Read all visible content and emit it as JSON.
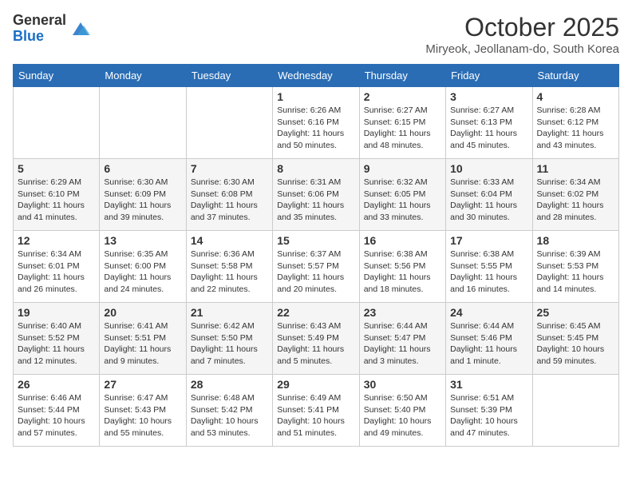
{
  "header": {
    "logo_general": "General",
    "logo_blue": "Blue",
    "month_title": "October 2025",
    "subtitle": "Miryeok, Jeollanam-do, South Korea"
  },
  "days_of_week": [
    "Sunday",
    "Monday",
    "Tuesday",
    "Wednesday",
    "Thursday",
    "Friday",
    "Saturday"
  ],
  "weeks": [
    [
      {
        "day": "",
        "info": ""
      },
      {
        "day": "",
        "info": ""
      },
      {
        "day": "",
        "info": ""
      },
      {
        "day": "1",
        "info": "Sunrise: 6:26 AM\nSunset: 6:16 PM\nDaylight: 11 hours\nand 50 minutes."
      },
      {
        "day": "2",
        "info": "Sunrise: 6:27 AM\nSunset: 6:15 PM\nDaylight: 11 hours\nand 48 minutes."
      },
      {
        "day": "3",
        "info": "Sunrise: 6:27 AM\nSunset: 6:13 PM\nDaylight: 11 hours\nand 45 minutes."
      },
      {
        "day": "4",
        "info": "Sunrise: 6:28 AM\nSunset: 6:12 PM\nDaylight: 11 hours\nand 43 minutes."
      }
    ],
    [
      {
        "day": "5",
        "info": "Sunrise: 6:29 AM\nSunset: 6:10 PM\nDaylight: 11 hours\nand 41 minutes."
      },
      {
        "day": "6",
        "info": "Sunrise: 6:30 AM\nSunset: 6:09 PM\nDaylight: 11 hours\nand 39 minutes."
      },
      {
        "day": "7",
        "info": "Sunrise: 6:30 AM\nSunset: 6:08 PM\nDaylight: 11 hours\nand 37 minutes."
      },
      {
        "day": "8",
        "info": "Sunrise: 6:31 AM\nSunset: 6:06 PM\nDaylight: 11 hours\nand 35 minutes."
      },
      {
        "day": "9",
        "info": "Sunrise: 6:32 AM\nSunset: 6:05 PM\nDaylight: 11 hours\nand 33 minutes."
      },
      {
        "day": "10",
        "info": "Sunrise: 6:33 AM\nSunset: 6:04 PM\nDaylight: 11 hours\nand 30 minutes."
      },
      {
        "day": "11",
        "info": "Sunrise: 6:34 AM\nSunset: 6:02 PM\nDaylight: 11 hours\nand 28 minutes."
      }
    ],
    [
      {
        "day": "12",
        "info": "Sunrise: 6:34 AM\nSunset: 6:01 PM\nDaylight: 11 hours\nand 26 minutes."
      },
      {
        "day": "13",
        "info": "Sunrise: 6:35 AM\nSunset: 6:00 PM\nDaylight: 11 hours\nand 24 minutes."
      },
      {
        "day": "14",
        "info": "Sunrise: 6:36 AM\nSunset: 5:58 PM\nDaylight: 11 hours\nand 22 minutes."
      },
      {
        "day": "15",
        "info": "Sunrise: 6:37 AM\nSunset: 5:57 PM\nDaylight: 11 hours\nand 20 minutes."
      },
      {
        "day": "16",
        "info": "Sunrise: 6:38 AM\nSunset: 5:56 PM\nDaylight: 11 hours\nand 18 minutes."
      },
      {
        "day": "17",
        "info": "Sunrise: 6:38 AM\nSunset: 5:55 PM\nDaylight: 11 hours\nand 16 minutes."
      },
      {
        "day": "18",
        "info": "Sunrise: 6:39 AM\nSunset: 5:53 PM\nDaylight: 11 hours\nand 14 minutes."
      }
    ],
    [
      {
        "day": "19",
        "info": "Sunrise: 6:40 AM\nSunset: 5:52 PM\nDaylight: 11 hours\nand 12 minutes."
      },
      {
        "day": "20",
        "info": "Sunrise: 6:41 AM\nSunset: 5:51 PM\nDaylight: 11 hours\nand 9 minutes."
      },
      {
        "day": "21",
        "info": "Sunrise: 6:42 AM\nSunset: 5:50 PM\nDaylight: 11 hours\nand 7 minutes."
      },
      {
        "day": "22",
        "info": "Sunrise: 6:43 AM\nSunset: 5:49 PM\nDaylight: 11 hours\nand 5 minutes."
      },
      {
        "day": "23",
        "info": "Sunrise: 6:44 AM\nSunset: 5:47 PM\nDaylight: 11 hours\nand 3 minutes."
      },
      {
        "day": "24",
        "info": "Sunrise: 6:44 AM\nSunset: 5:46 PM\nDaylight: 11 hours\nand 1 minute."
      },
      {
        "day": "25",
        "info": "Sunrise: 6:45 AM\nSunset: 5:45 PM\nDaylight: 10 hours\nand 59 minutes."
      }
    ],
    [
      {
        "day": "26",
        "info": "Sunrise: 6:46 AM\nSunset: 5:44 PM\nDaylight: 10 hours\nand 57 minutes."
      },
      {
        "day": "27",
        "info": "Sunrise: 6:47 AM\nSunset: 5:43 PM\nDaylight: 10 hours\nand 55 minutes."
      },
      {
        "day": "28",
        "info": "Sunrise: 6:48 AM\nSunset: 5:42 PM\nDaylight: 10 hours\nand 53 minutes."
      },
      {
        "day": "29",
        "info": "Sunrise: 6:49 AM\nSunset: 5:41 PM\nDaylight: 10 hours\nand 51 minutes."
      },
      {
        "day": "30",
        "info": "Sunrise: 6:50 AM\nSunset: 5:40 PM\nDaylight: 10 hours\nand 49 minutes."
      },
      {
        "day": "31",
        "info": "Sunrise: 6:51 AM\nSunset: 5:39 PM\nDaylight: 10 hours\nand 47 minutes."
      },
      {
        "day": "",
        "info": ""
      }
    ]
  ]
}
